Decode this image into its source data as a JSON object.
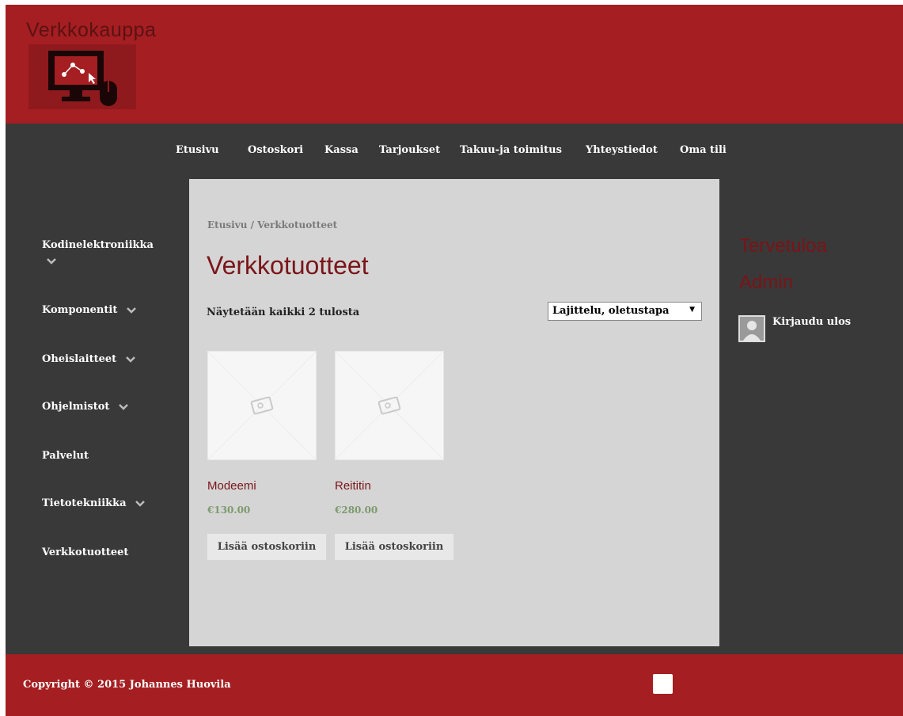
{
  "site": {
    "title": "Verkkokauppa"
  },
  "nav": [
    {
      "label": "Etusivu"
    },
    {
      "label": "Ostoskori"
    },
    {
      "label": "Kassa"
    },
    {
      "label": "Tarjoukset"
    },
    {
      "label": "Takuu-ja toimitus"
    },
    {
      "label": "Yhteystiedot"
    },
    {
      "label": "Oma tili"
    }
  ],
  "sidebar": {
    "items": [
      {
        "label": "Kodinelektroniikka",
        "has_submenu": true
      },
      {
        "label": "Komponentit",
        "has_submenu": true
      },
      {
        "label": "Oheislaitteet",
        "has_submenu": true
      },
      {
        "label": "Ohjelmistot",
        "has_submenu": true
      },
      {
        "label": "Palvelut",
        "has_submenu": false
      },
      {
        "label": "Tietotekniikka",
        "has_submenu": true
      },
      {
        "label": "Verkkotuotteet",
        "has_submenu": false
      }
    ]
  },
  "main": {
    "breadcrumb": "Etusivu / Verkkotuotteet",
    "title": "Verkkotuotteet",
    "result_count": "Näytetään kaikki 2 tulosta",
    "sort": {
      "selected": "Lajittelu, oletustapa"
    },
    "products": [
      {
        "name": "Modeemi",
        "price": "€130.00",
        "button": "Lisää ostoskoriin"
      },
      {
        "name": "Reititin",
        "price": "€280.00",
        "button": "Lisää ostoskoriin"
      }
    ]
  },
  "user": {
    "welcome_line1": "Tervetuloa",
    "welcome_line2": "Admin",
    "logout": "Kirjaudu ulos"
  },
  "footer": {
    "copyright": "Copyright © 2015 Johannes Huovila"
  },
  "colors": {
    "header": "#a51e21",
    "body": "#393939",
    "content": "#d5d5d5",
    "title": "#7a1519",
    "price": "#7d9a6e"
  },
  "icons": {
    "logo": "monitor-network-mouse-icon",
    "chevron": "chevron-down-icon",
    "placeholder": "image-placeholder-icon",
    "avatar": "user-avatar-icon",
    "sort_arrow": "dropdown-arrow-icon"
  }
}
